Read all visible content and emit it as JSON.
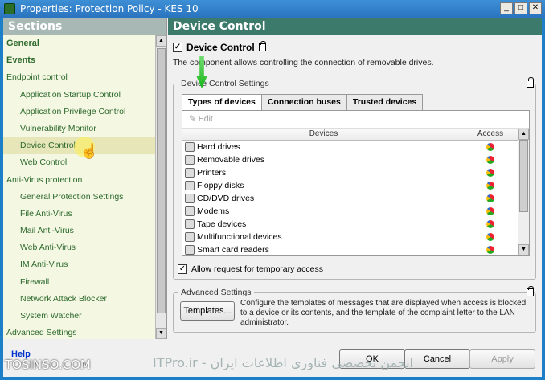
{
  "window": {
    "title": "Properties: Protection Policy - KES 10",
    "controls": {
      "minimize": "_",
      "maximize": "□",
      "close": "✕"
    }
  },
  "sidebar": {
    "header": "Sections",
    "items": [
      {
        "label": "General",
        "level": 0,
        "bold": true
      },
      {
        "label": "Events",
        "level": 0,
        "bold": true
      },
      {
        "label": "Endpoint control",
        "level": 0,
        "bold": false
      },
      {
        "label": "Application Startup Control",
        "level": 1
      },
      {
        "label": "Application Privilege Control",
        "level": 1
      },
      {
        "label": "Vulnerability Monitor",
        "level": 1
      },
      {
        "label": "Device Control",
        "level": 1,
        "selected": true
      },
      {
        "label": "Web Control",
        "level": 1
      },
      {
        "label": "Anti-Virus protection",
        "level": 0,
        "bold": false
      },
      {
        "label": "General Protection Settings",
        "level": 1
      },
      {
        "label": "File Anti-Virus",
        "level": 1
      },
      {
        "label": "Mail Anti-Virus",
        "level": 1
      },
      {
        "label": "Web Anti-Virus",
        "level": 1
      },
      {
        "label": "IM Anti-Virus",
        "level": 1
      },
      {
        "label": "Firewall",
        "level": 1
      },
      {
        "label": "Network Attack Blocker",
        "level": 1
      },
      {
        "label": "System Watcher",
        "level": 1
      },
      {
        "label": "Advanced Settings",
        "level": 0,
        "bold": false
      }
    ]
  },
  "main": {
    "header": "Device Control",
    "enable_label": "Device Control",
    "description": "The component allows controlling the connection of removable drives.",
    "settings_group": "Device Control Settings",
    "tabs": [
      "Types of devices",
      "Connection buses",
      "Trusted devices"
    ],
    "edit_label": "Edit",
    "columns": {
      "devices": "Devices",
      "access": "Access"
    },
    "devices": [
      {
        "name": "Hard drives",
        "icon": "hard-drive-icon"
      },
      {
        "name": "Removable drives",
        "icon": "usb-drive-icon"
      },
      {
        "name": "Printers",
        "icon": "printer-icon"
      },
      {
        "name": "Floppy disks",
        "icon": "floppy-icon"
      },
      {
        "name": "CD/DVD drives",
        "icon": "cd-icon"
      },
      {
        "name": "Modems",
        "icon": "modem-icon"
      },
      {
        "name": "Tape devices",
        "icon": "tape-icon"
      },
      {
        "name": "Multifunctional devices",
        "icon": "multifunction-icon"
      },
      {
        "name": "Smart card readers",
        "icon": "smartcard-icon"
      }
    ],
    "allow_temp_label": "Allow request for temporary access",
    "advanced_group": "Advanced Settings",
    "templates_button": "Templates...",
    "advanced_text": "Configure the templates of messages that are displayed when access is blocked to a device or its contents, and the template of the complaint letter to the LAN administrator."
  },
  "footer": {
    "help": "Help",
    "ok": "OK",
    "cancel": "Cancel",
    "apply": "Apply"
  },
  "watermark": {
    "left": "TOSINSO.COM",
    "right": "ITPro.ir - انجمن تخصصی فناوری اطلاعات ایران"
  }
}
